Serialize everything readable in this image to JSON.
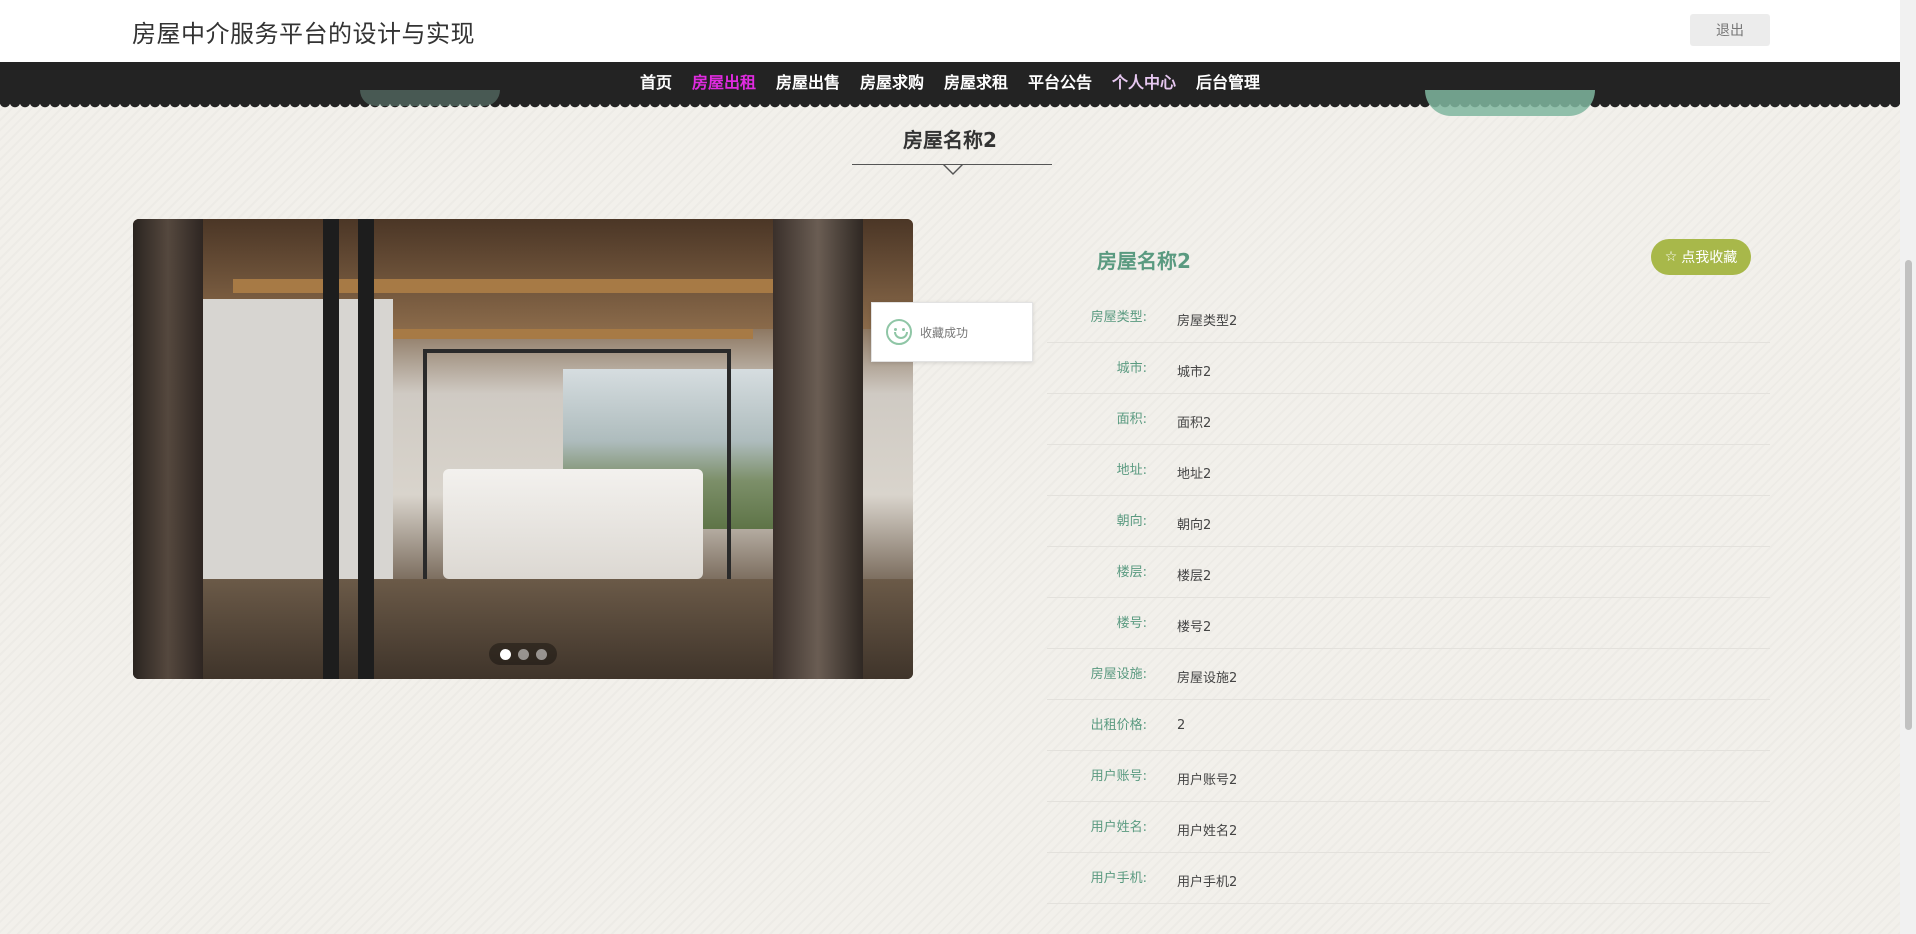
{
  "header": {
    "site_title": "房屋中介服务平台的设计与实现",
    "logout_label": "退出"
  },
  "nav": {
    "items": [
      {
        "label": "首页"
      },
      {
        "label": "房屋出租"
      },
      {
        "label": "房屋出售"
      },
      {
        "label": "房屋求购"
      },
      {
        "label": "房屋求租"
      },
      {
        "label": "平台公告"
      },
      {
        "label": "个人中心"
      },
      {
        "label": "后台管理"
      }
    ],
    "active_index": 1
  },
  "page": {
    "heading": "房屋名称2"
  },
  "carousel": {
    "slide_count": 3,
    "active_slide": 0
  },
  "toast": {
    "message": "收藏成功",
    "icon": "smile-icon"
  },
  "detail": {
    "title": "房屋名称2",
    "favorite_label": "点我收藏",
    "favorite_icon": "star-icon",
    "fields": [
      {
        "label": "房屋类型:",
        "value": "房屋类型2"
      },
      {
        "label": "城市:",
        "value": "城市2"
      },
      {
        "label": "面积:",
        "value": "面积2"
      },
      {
        "label": "地址:",
        "value": "地址2"
      },
      {
        "label": "朝向:",
        "value": "朝向2"
      },
      {
        "label": "楼层:",
        "value": "楼层2"
      },
      {
        "label": "楼号:",
        "value": "楼号2"
      },
      {
        "label": "房屋设施:",
        "value": "房屋设施2"
      },
      {
        "label": "出租价格:",
        "value": "2"
      },
      {
        "label": "用户账号:",
        "value": "用户账号2"
      },
      {
        "label": "用户姓名:",
        "value": "用户姓名2"
      },
      {
        "label": "用户手机:",
        "value": "用户手机2"
      }
    ]
  },
  "colors": {
    "accent_green": "#5a9a80",
    "nav_active": "#e02be0",
    "favorite_button": "#a8b84a",
    "navbar_bg": "#232323"
  }
}
